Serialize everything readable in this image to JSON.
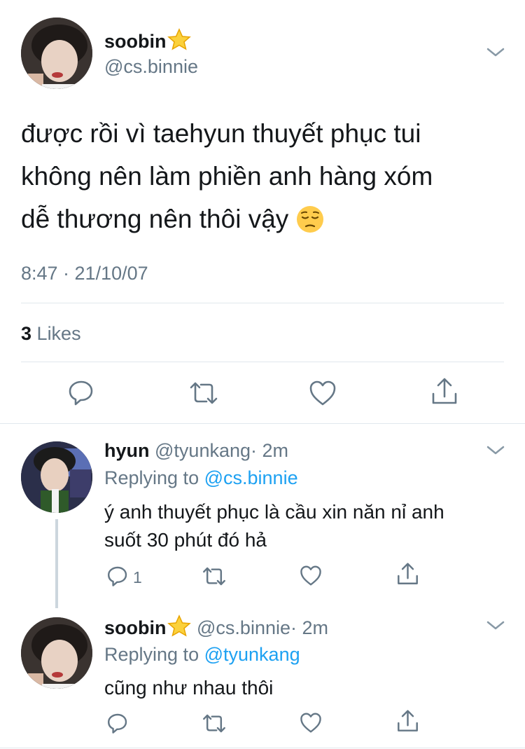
{
  "main_tweet": {
    "display_name": "soobin",
    "handle": "@cs.binnie",
    "text_lines": [
      "được rồi vì taehyun thuyết phục tui",
      "không nên làm phiền anh hàng xóm",
      "dễ thương nên thôi vậy"
    ],
    "timestamp": "8:47 · 21/10/07",
    "likes_count": "3",
    "likes_label": "Likes"
  },
  "replies": [
    {
      "display_name": "hyun",
      "handle": "@tyunkang",
      "time": "· 2m",
      "replying_prefix": "Replying to",
      "replying_to": "@cs.binnie",
      "text_lines": [
        "ý anh thuyết phục là cầu xin năn nỉ anh",
        "suốt 30 phút đó hả"
      ],
      "reply_count": "1"
    },
    {
      "display_name": "soobin",
      "handle": "@cs.binnie",
      "time": "· 2m",
      "replying_prefix": "Replying to",
      "replying_to": "@tyunkang",
      "text_lines": [
        "cũng như nhau thôi"
      ],
      "reply_count": ""
    }
  ],
  "colors": {
    "accent": "#1da1f2",
    "muted": "#657786",
    "icon": "#657786",
    "divider": "#e1e8ed"
  },
  "icons": [
    "chevron-down-icon",
    "star-icon",
    "pensive-face-icon",
    "reply-icon",
    "retweet-icon",
    "like-icon",
    "share-icon"
  ]
}
